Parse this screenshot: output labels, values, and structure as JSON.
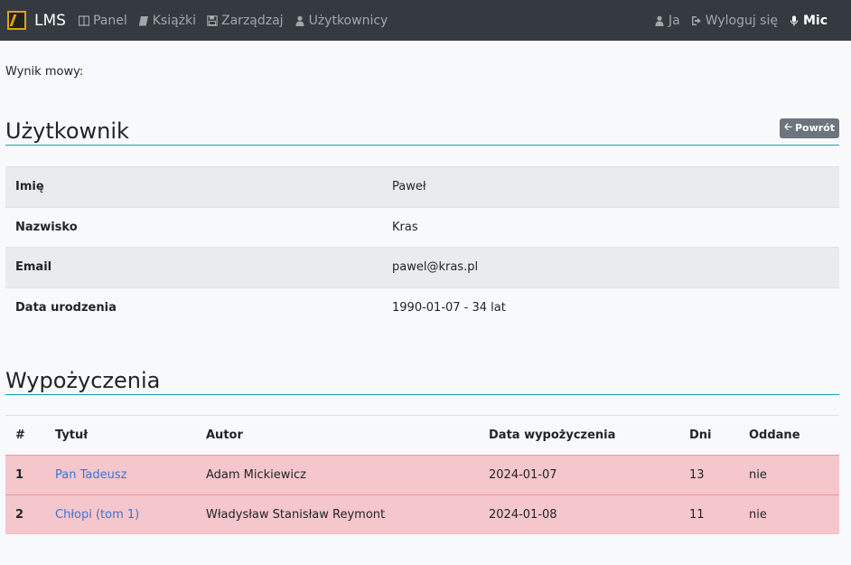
{
  "nav": {
    "brand": "LMS",
    "links": [
      {
        "label": "Panel",
        "icon": "columns-icon"
      },
      {
        "label": "Książki",
        "icon": "book-icon"
      },
      {
        "label": "Zarządzaj",
        "icon": "save-icon"
      },
      {
        "label": "Użytkownicy",
        "icon": "user-icon"
      }
    ],
    "right": [
      {
        "label": "Ja",
        "icon": "user-icon"
      },
      {
        "label": "Wyloguj się",
        "icon": "sign-out-icon"
      },
      {
        "label": "Mic",
        "icon": "microphone-icon"
      }
    ]
  },
  "speech_result_label": "Wynik mowy:",
  "user_section": {
    "title": "Użytkownik",
    "back_label": "Powrót",
    "rows": [
      {
        "label": "Imię",
        "value": "Paweł"
      },
      {
        "label": "Nazwisko",
        "value": "Kras"
      },
      {
        "label": "Email",
        "value": "pawel@kras.pl"
      },
      {
        "label": "Data urodzenia",
        "value": "1990-01-07 - 34 lat"
      }
    ]
  },
  "loans_section": {
    "title": "Wypożyczenia",
    "headers": [
      "#",
      "Tytuł",
      "Autor",
      "Data wypożyczenia",
      "Dni",
      "Oddane"
    ],
    "rows": [
      {
        "no": "1",
        "title": "Pan Tadeusz",
        "author": "Adam Mickiewicz",
        "date": "2024-01-07",
        "days": "13",
        "returned": "nie"
      },
      {
        "no": "2",
        "title": "Chłopi (tom 1)",
        "author": "Władysław Stanisław Reymont",
        "date": "2024-01-08",
        "days": "11",
        "returned": "nie"
      }
    ]
  },
  "colors": {
    "navbar": "#343a40",
    "accent_line": "#17a2b8",
    "overdue_row": "#f5c6cb",
    "link": "#3c74d0"
  }
}
